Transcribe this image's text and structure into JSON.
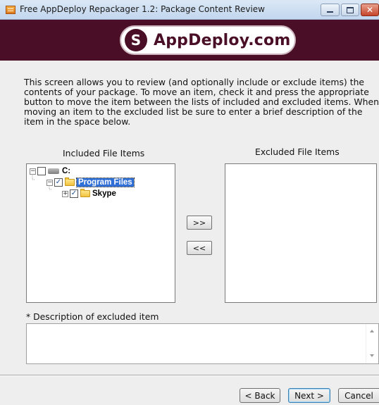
{
  "window": {
    "title": "Free AppDeploy Repackager 1.2: Package Content Review",
    "close_glyph": "✕"
  },
  "banner": {
    "logo_symbol": "S",
    "logo_text": "AppDeploy.com"
  },
  "intro_text": "This screen allows you to review (and optionally include or exclude items) the contents of your package. To move an item, check it and press the appropriate button to move the item between the lists of included and excluded items. When moving an item to the excluded list be sure to enter a brief description of the item in the space below.",
  "included": {
    "label": "Included File Items",
    "tree": [
      {
        "label": "C:",
        "checked": false,
        "icon": "drive-icon",
        "expanded": true
      },
      {
        "label": "Program Files",
        "checked": true,
        "icon": "folder-open-icon",
        "expanded": true,
        "selected": true
      },
      {
        "label": "Skype",
        "checked": true,
        "icon": "folder-icon",
        "expanded": false
      }
    ],
    "check_glyph": "✓",
    "expanded_glyph": "−",
    "collapsed_glyph": "+"
  },
  "excluded": {
    "label": "Excluded File Items",
    "items": []
  },
  "move_buttons": {
    "to_excluded": ">>",
    "to_included": "<<"
  },
  "description": {
    "label": "* Description of excluded item",
    "value": ""
  },
  "footer": {
    "back": "< Back",
    "next": "Next >",
    "cancel": "Cancel"
  }
}
